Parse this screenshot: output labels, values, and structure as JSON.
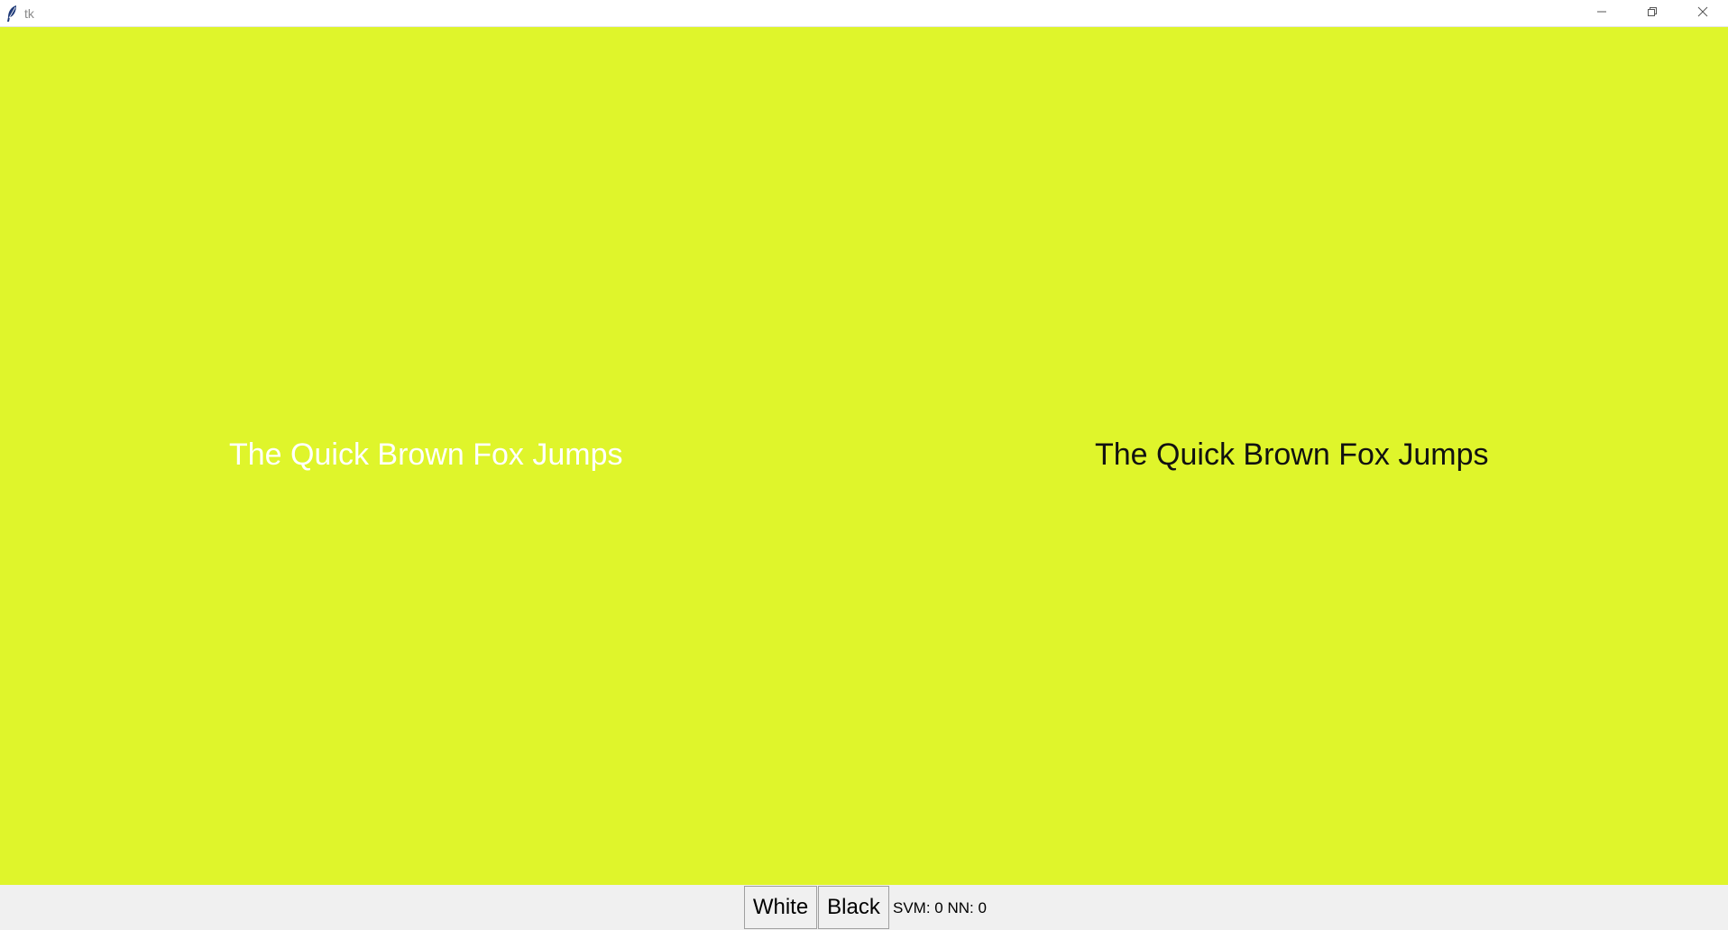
{
  "window": {
    "title": "tk",
    "controls": {
      "minimize_icon": "minimize-icon",
      "maximize_icon": "restore-icon",
      "close_icon": "close-icon"
    }
  },
  "canvas": {
    "background_color": "#dff52b",
    "left_text": "The Quick Brown Fox Jumps",
    "left_text_color": "#ffffff",
    "right_text": "The Quick Brown Fox Jumps",
    "right_text_color": "#111111"
  },
  "bottom": {
    "white_button_label": "White",
    "black_button_label": "Black",
    "status_text": "SVM: 0 NN: 0"
  }
}
